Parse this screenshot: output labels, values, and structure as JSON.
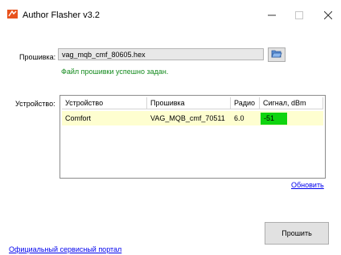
{
  "window": {
    "title": "Author Flasher v3.2",
    "icon": "author-flasher-logo"
  },
  "firmware": {
    "label": "Прошивка:",
    "value": "vag_mqb_cmf_80605.hex",
    "browse_icon": "folder-open-icon",
    "status": "Файл прошивки успешно задан.",
    "status_color": "#138a1d"
  },
  "device": {
    "label": "Устройство:",
    "columns": [
      "Устройство",
      "Прошивка",
      "Радио",
      "Сигнал, dBm"
    ],
    "rows": [
      {
        "device": "Comfort",
        "firmware": "VAG_MQB_cmf_70511",
        "radio": "6.0",
        "signal": "-51",
        "signal_color": "#0fd40f",
        "selected_color": "#fefed0"
      }
    ],
    "refresh_label": "Обновить"
  },
  "actions": {
    "flash_label": "Прошить"
  },
  "footer": {
    "portal_link": "Официальный сервисный портал"
  },
  "colors": {
    "link": "#0000ee",
    "button_bg": "#e1e1e1"
  }
}
